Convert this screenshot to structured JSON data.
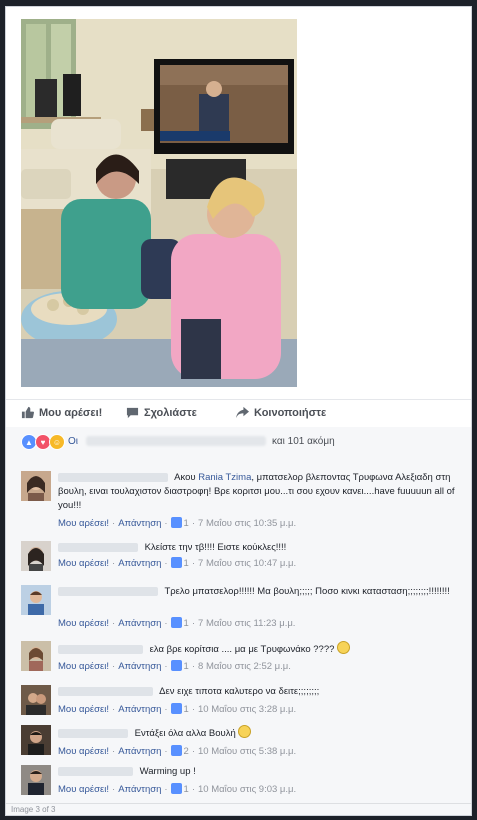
{
  "post": {
    "photo_icon": "photo-of-two-women-watching-tv"
  },
  "actions": {
    "like_label": "Μου αρέσει!",
    "comment_label": "Σχολιάστε",
    "share_label": "Κοινοποιήστε"
  },
  "reactions": {
    "name_prefix": "Οι",
    "count_text": "και 101 ακόμη"
  },
  "comments": [
    {
      "text_before": "Ακου",
      "mention": "Rania Tzima",
      "text_after": ", μπατσελορ βλεποντας Τρυφωνα Αλεξιαδη στη βουλη, ειναι τουλαχιστον διαστροφη! Βρε κοριτσι μου...τι σου εχουν κανει....have fuuuuun all of you!!!",
      "like_label": "Μου αρέσει!",
      "reply_label": "Απάντηση",
      "likes": "1",
      "time": "7 Μαΐου στις 10:35 μ.μ."
    },
    {
      "text_before": "",
      "mention": "",
      "text_after": "Κλείστε την τβ!!!! Ειστε κούκλες!!!!",
      "like_label": "Μου αρέσει!",
      "reply_label": "Απάντηση",
      "likes": "1",
      "time": "7 Μαΐου στις 10:47 μ.μ."
    },
    {
      "text_before": "",
      "mention": "",
      "text_after": "Τρελο μπατσελορ!!!!!! Μα βουλη;;;;; Ποσο κινκι κατασταση;;;;;;;;!!!!!!!!",
      "like_label": "Μου αρέσει!",
      "reply_label": "Απάντηση",
      "likes": "1",
      "time": "7 Μαΐου στις 11:23 μ.μ."
    },
    {
      "text_before": "",
      "mention": "",
      "text_after": "ελα βρε κορίτσια .... μα με Τρυφωνάκο ????",
      "like_label": "Μου αρέσει!",
      "reply_label": "Απάντηση",
      "likes": "1",
      "time": "8 Μαΐου στις 2:52 μ.μ."
    },
    {
      "text_before": "",
      "mention": "",
      "text_after": "Δεν ειχε τιποτα καλυτερο να δειτε;;;;;;;;",
      "like_label": "Μου αρέσει!",
      "reply_label": "Απάντηση",
      "likes": "1",
      "time": "10 Μαΐου στις 3:28 μ.μ."
    },
    {
      "text_before": "",
      "mention": "",
      "text_after": "Εντάξει όλα αλλα Βουλή",
      "like_label": "Μου αρέσει!",
      "reply_label": "Απάντηση",
      "likes": "2",
      "time": "10 Μαΐου στις 5:38 μ.μ."
    },
    {
      "text_before": "",
      "mention": "",
      "text_after": "Warming up !",
      "like_label": "Μου αρέσει!",
      "reply_label": "Απάντηση",
      "likes": "1",
      "time": "10 Μαΐου στις 9:03 μ.μ."
    }
  ],
  "footer": {
    "page_indicator": "Image 3 of 3"
  },
  "colors": {
    "link": "#365899",
    "meta": "#90949c",
    "like_blue": "#5890ff"
  }
}
